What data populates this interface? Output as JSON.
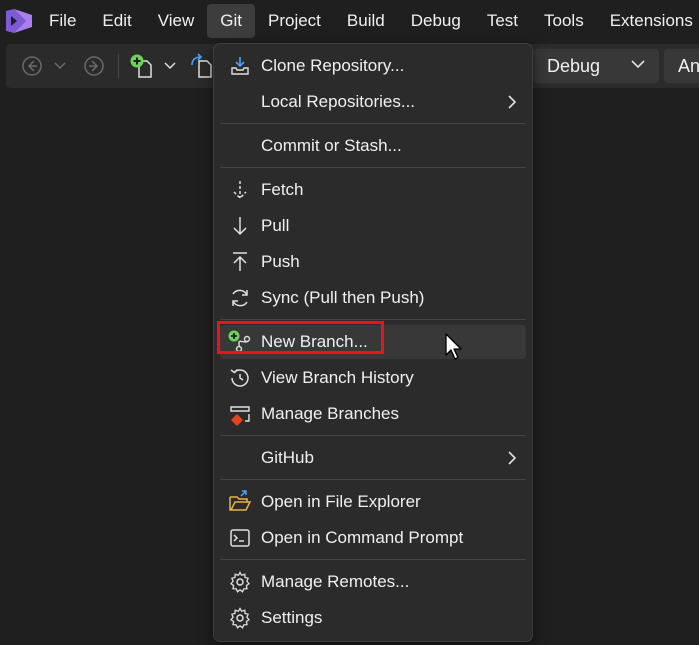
{
  "menubar": {
    "items": [
      "File",
      "Edit",
      "View",
      "Git",
      "Project",
      "Build",
      "Debug",
      "Test",
      "Tools",
      "Extensions"
    ],
    "active_index": 3
  },
  "toolbar": {
    "configuration": "Debug",
    "platform": "An"
  },
  "git_menu": {
    "items": [
      {
        "label": "Clone Repository...",
        "icon": "clone-repository-icon"
      },
      {
        "label": "Local Repositories...",
        "has_submenu": true
      },
      {
        "label": "Commit or Stash..."
      },
      {
        "label": "Fetch",
        "icon": "fetch-arrow-down-icon"
      },
      {
        "label": "Pull",
        "icon": "pull-arrow-down-icon"
      },
      {
        "label": "Push",
        "icon": "push-arrow-up-icon"
      },
      {
        "label": "Sync (Pull then Push)",
        "icon": "sync-icon"
      },
      {
        "label": "New Branch...",
        "icon": "new-branch-icon",
        "hovered": true,
        "highlighted": true
      },
      {
        "label": "View Branch History",
        "icon": "history-icon"
      },
      {
        "label": "Manage Branches",
        "icon": "manage-branches-icon"
      },
      {
        "label": "GitHub",
        "has_submenu": true
      },
      {
        "label": "Open in File Explorer",
        "icon": "folder-open-icon"
      },
      {
        "label": "Open in Command Prompt",
        "icon": "terminal-icon"
      },
      {
        "label": "Manage Remotes...",
        "icon": "gear-icon"
      },
      {
        "label": "Settings",
        "icon": "gear-icon"
      }
    ]
  },
  "colors": {
    "background": "#1f1f1f",
    "menu_background": "#2b2b2b",
    "hover": "#383838",
    "highlight_border": "#e8131b",
    "logo": "#a97ef0",
    "add_badge": "#6fd35a"
  }
}
